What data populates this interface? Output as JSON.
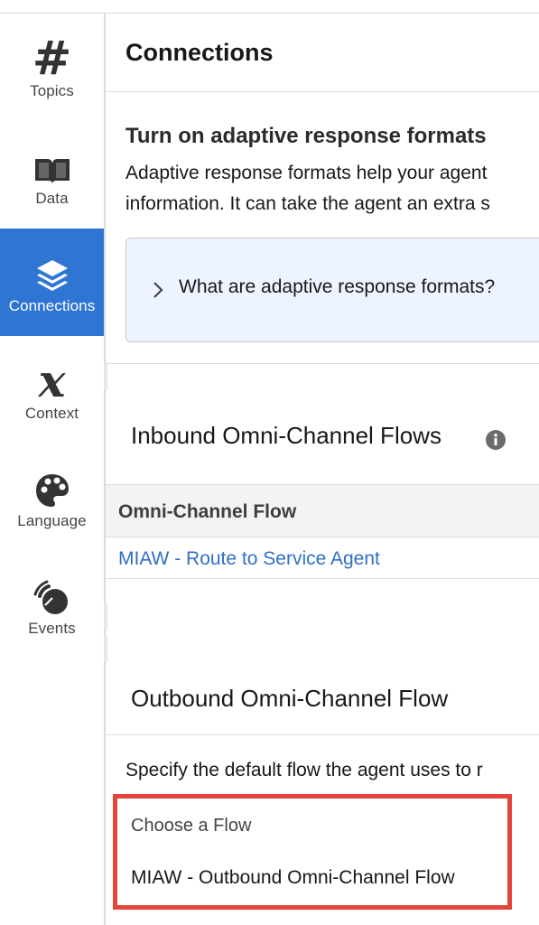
{
  "sidebar": {
    "items": [
      {
        "label": "Topics",
        "icon": "hash-icon"
      },
      {
        "label": "Data",
        "icon": "book-icon"
      },
      {
        "label": "Connections",
        "icon": "layers-icon",
        "active": true
      },
      {
        "label": "Context",
        "icon": "variable-x-icon"
      },
      {
        "label": "Language",
        "icon": "palette-icon"
      },
      {
        "label": "Events",
        "icon": "signal-icon"
      }
    ]
  },
  "header": {
    "title": "Connections"
  },
  "adaptive": {
    "title": "Turn on adaptive response formats",
    "description_line1": "Adaptive response formats help your agent",
    "description_line2": "information. It can take the agent an extra s",
    "accordion_label": "What are adaptive response formats?"
  },
  "inbound": {
    "title": "Inbound Omni-Channel Flows",
    "table": {
      "column_header": "Omni-Channel Flow",
      "rows": [
        "MIAW - Route to Service Agent"
      ]
    }
  },
  "outbound": {
    "title": "Outbound Omni-Channel Flow",
    "description": "Specify the default flow the agent uses to r",
    "choose_label": "Choose a Flow",
    "selected_flow": "MIAW - Outbound Omni-Channel Flow"
  },
  "colors": {
    "accent": "#2f75d3",
    "link": "#2f6fc7",
    "highlight": "#e2453b",
    "accordion_bg": "#eef4ff"
  }
}
